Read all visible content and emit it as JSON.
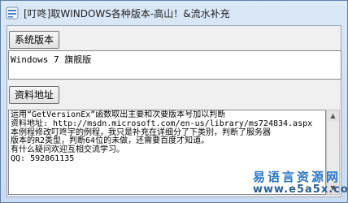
{
  "window": {
    "title": "[叮咚]取WINDOWS各种版本-高山！&流水补充"
  },
  "buttons": {
    "system_version": "系统版本",
    "reference_link": "资料地址"
  },
  "version_field": {
    "value": "Windows 7 旗舰版"
  },
  "info_text": {
    "lines": [
      "运用“GetVersionEx”函数取出主要和次要版本号加以判断",
      "资料地址: http://msdn.microsoft.com/en-us/library/ms724834.aspx",
      "本例程修改叮咚宇的例程，我只是补充在详细分了下类别，判断了服务器",
      "版本的R2类型，判断64位的未做，还需要百度才知道。",
      "有什么疑问欢迎互相交流学习。",
      "QQ: 592861135"
    ]
  },
  "watermark": {
    "name": "易语言资源网",
    "url": "www.e5a5x.com"
  }
}
